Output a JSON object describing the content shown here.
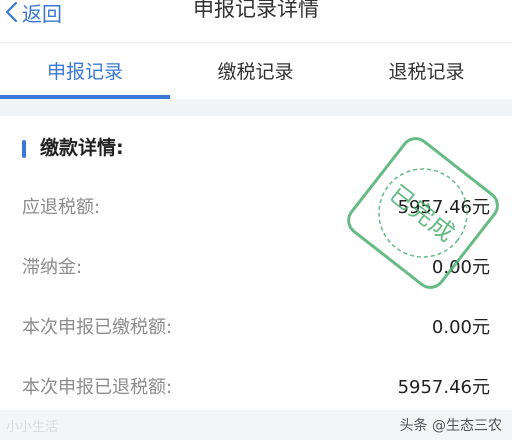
{
  "nav": {
    "back_label": "返回",
    "title": "申报记录详情"
  },
  "tabs": [
    {
      "label": "申报记录",
      "active": true
    },
    {
      "label": "缴税记录",
      "active": false
    },
    {
      "label": "退税记录",
      "active": false
    }
  ],
  "section": {
    "title": "缴款详情:"
  },
  "rows": [
    {
      "label": "应退税额:",
      "value": "5957.46元"
    },
    {
      "label": "滞纳金:",
      "value": "0.00元"
    },
    {
      "label": "本次申报已缴税额:",
      "value": "0.00元"
    },
    {
      "label": "本次申报已退税额:",
      "value": "5957.46元"
    }
  ],
  "stamp": {
    "text": "已完成",
    "color": "#4caf6f"
  },
  "footer": {
    "watermark_left": "小小生活",
    "watermark_right": "头条 @生态三农"
  },
  "colors": {
    "accent": "#3a78d6"
  }
}
